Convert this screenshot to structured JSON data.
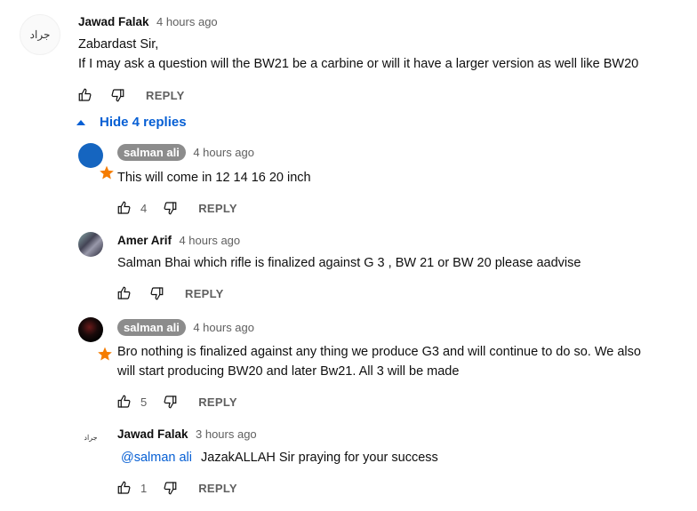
{
  "top_comment": {
    "author": "Jawad Falak",
    "time": "4 hours ago",
    "avatar_text": "جراد",
    "lines": [
      "Zabardast Sir,",
      "If I may ask a question will the BW21 be a carbine or will it have a larger version as well like BW20"
    ],
    "reply_label": "REPLY"
  },
  "replies_toggle": {
    "label": "Hide 4 replies"
  },
  "replies": [
    {
      "author": "salman ali",
      "time": "4 hours ago",
      "text": "This will come in 12 14 16 20 inch",
      "likes": "4",
      "reply_label": "REPLY"
    },
    {
      "author": "Amer Arif",
      "time": "4 hours ago",
      "text": "Salman Bhai which rifle is finalized against G 3 , BW 21 or BW 20 please aadvise",
      "likes": "",
      "reply_label": "REPLY"
    },
    {
      "author": "salman ali",
      "time": "4 hours ago",
      "lines": [
        "Bro nothing is finalized against any thing we produce G3 and will continue to do so. We also",
        "will start producing BW20 and later Bw21. All 3 will be made"
      ],
      "likes": "5",
      "reply_label": "REPLY"
    },
    {
      "author": "Jawad Falak",
      "time": "3 hours ago",
      "avatar_text": "جراد",
      "mention": "@salman ali",
      "text": "JazakALLAH Sir praying for your success",
      "likes": "1",
      "reply_label": "REPLY"
    }
  ],
  "colors": {
    "accent": "#065fd4",
    "chip": "#8c8c8c",
    "badge": "#f57c00",
    "muted": "#606060"
  },
  "icons": [
    "thumb-up-icon",
    "thumb-down-icon",
    "caret-up-icon",
    "star-badge-icon"
  ]
}
